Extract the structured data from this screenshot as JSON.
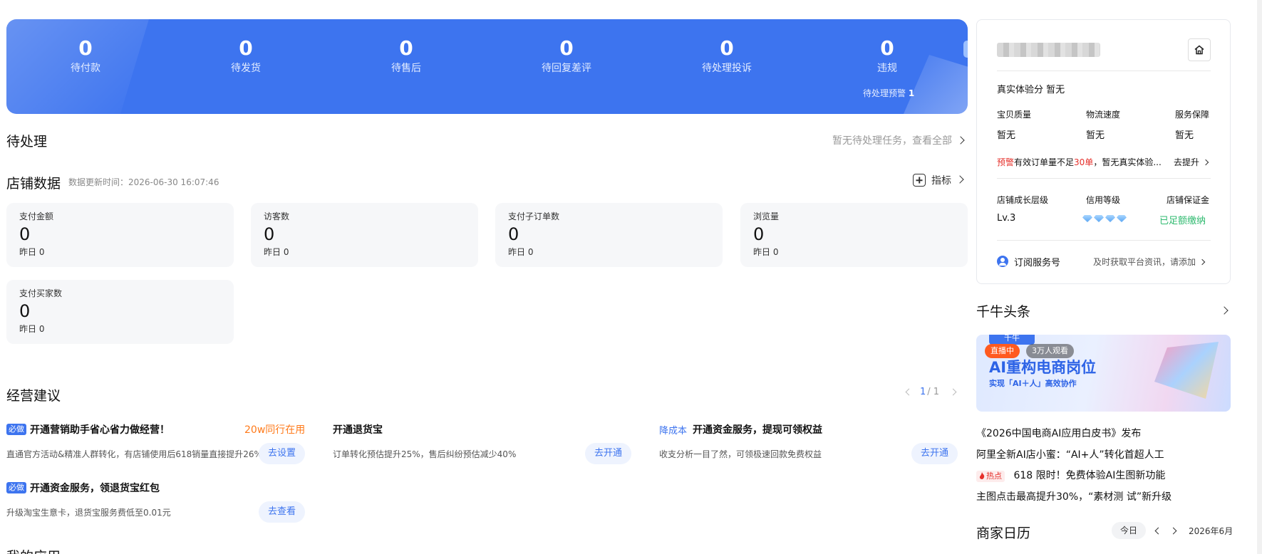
{
  "banner": {
    "stats": [
      {
        "value": "0",
        "label": "待付款"
      },
      {
        "value": "0",
        "label": "待发货"
      },
      {
        "value": "0",
        "label": "待售后"
      },
      {
        "value": "0",
        "label": "待回复差评"
      },
      {
        "value": "0",
        "label": "待处理投诉"
      },
      {
        "value": "0",
        "label": "违规"
      }
    ],
    "pending_warning_label": "待处理预警",
    "pending_warning_count": "1"
  },
  "pending": {
    "title": "待处理",
    "link": "暂无待处理任务，查看全部"
  },
  "store_data": {
    "title": "店铺数据",
    "update_time": "数据更新时间：2026-06-30 16:07:46",
    "metrics_button": "指标",
    "cards": [
      {
        "label": "支付金额",
        "value": "0",
        "yesterday": "昨日 0"
      },
      {
        "label": "访客数",
        "value": "0",
        "yesterday": "昨日 0"
      },
      {
        "label": "支付子订单数",
        "value": "0",
        "yesterday": "昨日 0"
      },
      {
        "label": "浏览量",
        "value": "0",
        "yesterday": "昨日 0"
      },
      {
        "label": "支付买家数",
        "value": "0",
        "yesterday": "昨日 0"
      }
    ]
  },
  "advice": {
    "title": "经营建议",
    "pager": {
      "current": "1",
      "total": "/ 1"
    },
    "items": [
      {
        "tag": "必做",
        "title": "开通营销助手省心省力做经营！",
        "hot": "20w同行在用",
        "desc": "直通官方活动&精准人群转化，有店铺使用后618销量直接提升26%",
        "button": "去设置"
      },
      {
        "tag": "",
        "title": "开通退货宝",
        "hot": "",
        "desc": "订单转化预估提升25%，售后纠纷预估减少40%",
        "button": "去开通"
      },
      {
        "tag": "降成本",
        "title": "开通资金服务，提现可领权益",
        "hot": "",
        "desc": "收支分析一目了然，可领极速回款免费权益",
        "button": "去开通"
      },
      {
        "tag": "必做",
        "title": "开通资金服务，领退货宝红包",
        "hot": "",
        "desc": "升级淘宝生意卡，退货宝服务费低至0.01元",
        "button": "去查看"
      }
    ]
  },
  "next_section_title": "我的应用",
  "shop_panel": {
    "score_label": "真实体验分",
    "score_value": "暂无",
    "quality_label": "宝贝质量",
    "quality_value": "暂无",
    "logistics_label": "物流速度",
    "logistics_value": "暂无",
    "service_label": "服务保障",
    "service_value": "暂无",
    "warn_tag": "预警",
    "warn_text_a": "有效订单量不足",
    "warn_num": "30单",
    "warn_text_b": "，暂无真实体验...",
    "warn_action": "去提升",
    "growth_label": "店铺成长层级",
    "growth_value": "Lv.3",
    "credit_label": "信用等级",
    "deposit_label": "店铺保证金",
    "deposit_value": "已足额缴纳",
    "subscribe_label": "订阅服务号",
    "subscribe_desc": "及时获取平台资讯，请添加"
  },
  "news": {
    "title": "千牛头条",
    "banner_logo": "千牛",
    "banner_live": "直播中",
    "banner_viewers": "3万人观看",
    "banner_headline": "AI重构电商岗位",
    "banner_sub": "实现「AI＋人」高效协作",
    "items": [
      {
        "tag": "",
        "text": "《2026中国电商AI应用白皮书》发布"
      },
      {
        "tag": "",
        "text": "阿里全新AI店小蜜：“AI+人”转化首超人工"
      },
      {
        "tag": "热点",
        "text": "618 限时！免费体验AI生图新功能"
      },
      {
        "tag": "",
        "text": "主图点击最高提升30%，“素材测 试”新升级"
      }
    ]
  },
  "calendar": {
    "title": "商家日历",
    "today": "今日",
    "month": "2026年6月"
  },
  "colors": {
    "brand_blue": "#3d74ef",
    "warn_red": "#e5302b",
    "hot_orange": "#ff7a1a",
    "ok_green": "#2fba6f"
  }
}
